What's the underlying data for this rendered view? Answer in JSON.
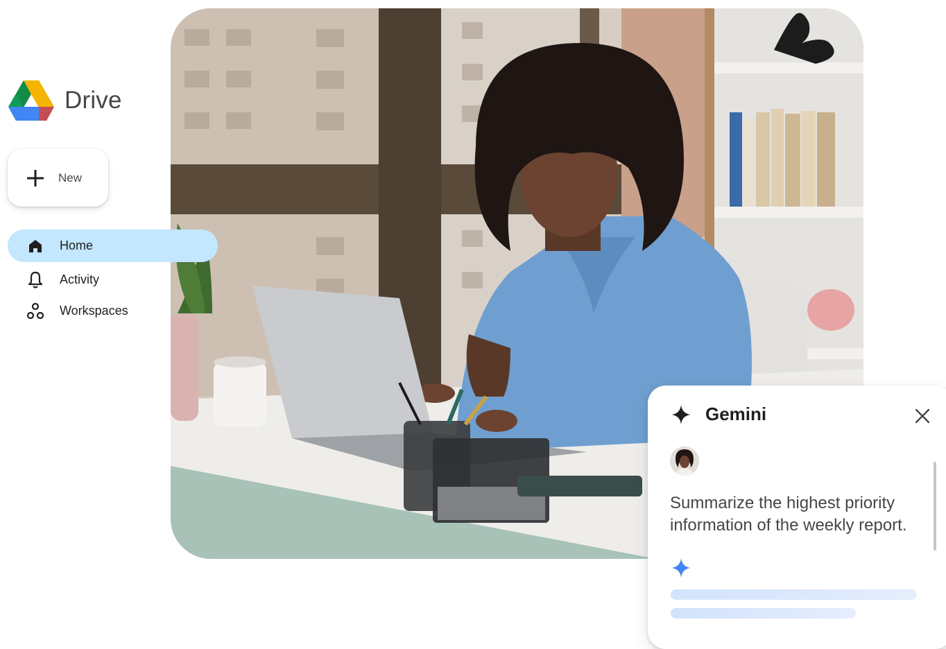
{
  "app": {
    "name": "Drive",
    "logo_icon": "google-drive-logo-icon"
  },
  "sidebar": {
    "new_button": {
      "label": "New",
      "icon": "plus-icon"
    },
    "items": [
      {
        "label": "Home",
        "icon": "home-icon",
        "active": true
      },
      {
        "label": "Activity",
        "icon": "bell-icon",
        "active": false
      },
      {
        "label": "Workspaces",
        "icon": "workspaces-icon",
        "active": false
      }
    ]
  },
  "gemini": {
    "title": "Gemini",
    "icon": "gemini-sparkle-icon",
    "close_icon": "close-icon",
    "prompt": "Summarize the highest priority information of the weekly report.",
    "response_state": "loading"
  },
  "colors": {
    "active_nav": "#c2e7ff",
    "gemini_spark": "#4285f4",
    "skeleton": "#d3e3fd",
    "drive_green": "#0f9d58",
    "drive_yellow": "#f4b400",
    "drive_blue": "#4285f4",
    "drive_red": "#db4437"
  }
}
